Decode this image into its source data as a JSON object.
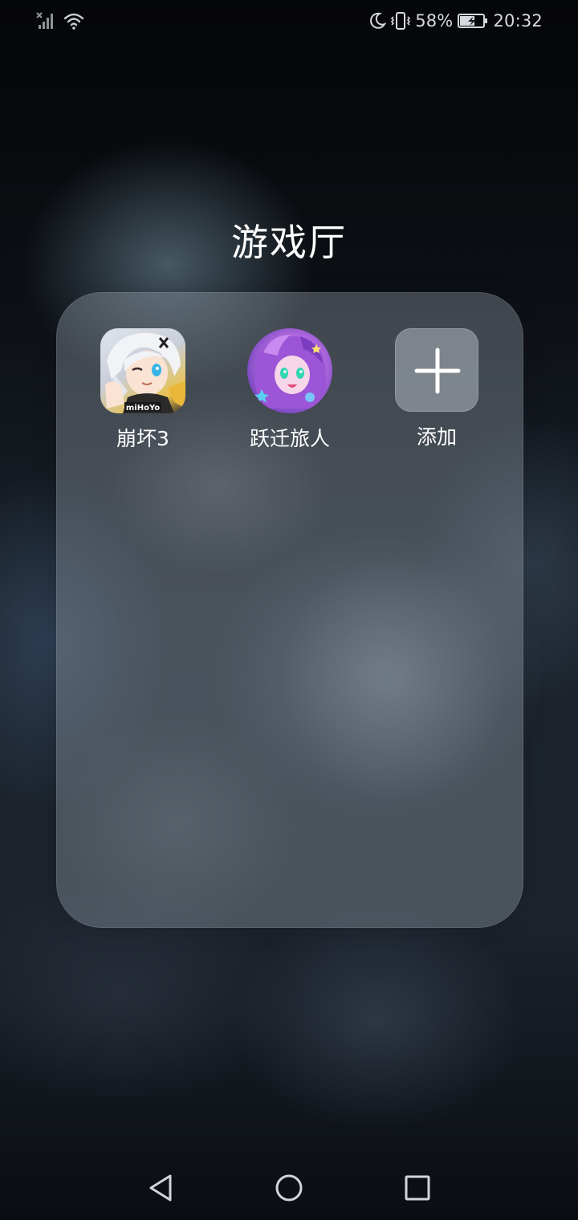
{
  "status_bar": {
    "battery": "58%",
    "time": "20:32",
    "icons": [
      "signal-off-icon",
      "wifi-icon",
      "moon-icon",
      "vibrate-icon",
      "battery-charging-icon"
    ]
  },
  "folder": {
    "title": "游戏厅",
    "apps": [
      {
        "label": "崩坏3",
        "icon": "honkai3-app-icon",
        "icon_text": "miHoYo"
      },
      {
        "label": "跃迁旅人",
        "icon": "travel-app-icon"
      },
      {
        "label": "添加",
        "icon": "plus-icon"
      }
    ]
  },
  "nav_bar": {
    "buttons": [
      "back-icon",
      "home-icon",
      "recents-icon"
    ]
  }
}
